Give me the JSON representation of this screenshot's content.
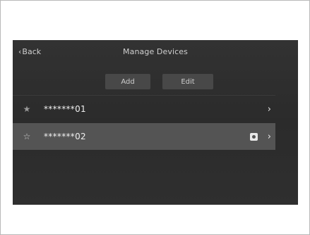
{
  "header": {
    "back_label": "Back",
    "title": "Manage Devices"
  },
  "toolbar": {
    "add_label": "Add",
    "edit_label": "Edit"
  },
  "devices": [
    {
      "name": "*******01",
      "favorite_icon": "star-filled-icon",
      "selected": false
    },
    {
      "name": "*******02",
      "favorite_icon": "star-outline-icon",
      "selected": true,
      "status_icon": "device-icon"
    }
  ],
  "colors": {
    "screen_bg": "#2f2f2f",
    "selected_row": "#545454",
    "button_bg": "#484848"
  }
}
